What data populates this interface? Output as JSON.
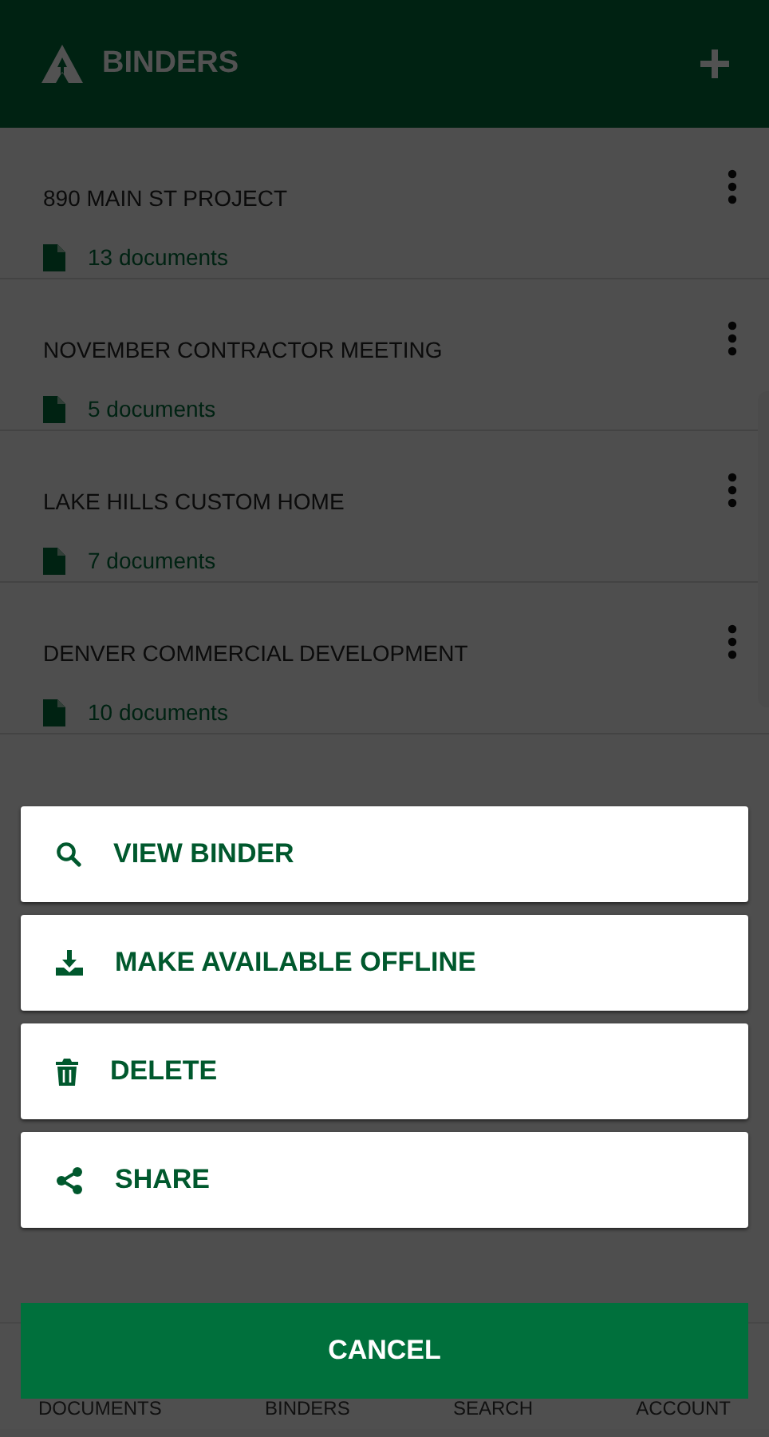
{
  "header": {
    "title": "BINDERS"
  },
  "binders": [
    {
      "name": "890 MAIN ST PROJECT",
      "count": "13 documents"
    },
    {
      "name": "NOVEMBER CONTRACTOR MEETING",
      "count": "5 documents"
    },
    {
      "name": "LAKE HILLS CUSTOM HOME",
      "count": "7 documents"
    },
    {
      "name": "DENVER COMMERCIAL DEVELOPMENT",
      "count": "10 documents"
    }
  ],
  "bottom_nav": [
    "DOCUMENTS",
    "BINDERS",
    "SEARCH",
    "ACCOUNT"
  ],
  "action_sheet": {
    "actions": [
      {
        "kind": "view",
        "label": "VIEW BINDER"
      },
      {
        "kind": "download",
        "label": "MAKE AVAILABLE OFFLINE"
      },
      {
        "kind": "delete",
        "label": "DELETE"
      },
      {
        "kind": "share",
        "label": "SHARE"
      }
    ],
    "cancel": "CANCEL"
  }
}
